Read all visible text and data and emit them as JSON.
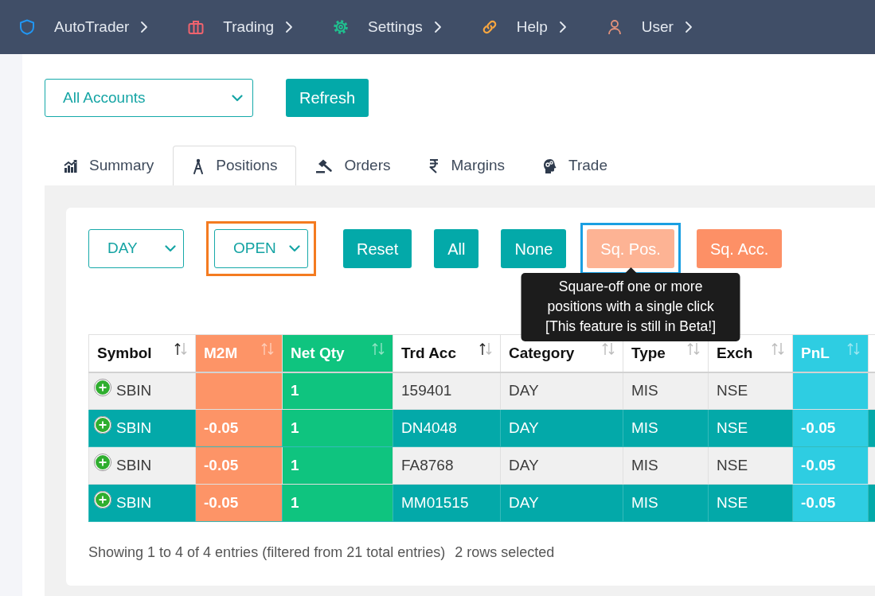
{
  "navbar": {
    "items": [
      {
        "label": "AutoTrader"
      },
      {
        "label": "Trading"
      },
      {
        "label": "Settings"
      },
      {
        "label": "Help"
      },
      {
        "label": "User"
      }
    ]
  },
  "toolbar": {
    "account_select": {
      "value": "All Accounts"
    },
    "refresh_button": {
      "label": "Refresh"
    }
  },
  "tabs": [
    {
      "label": "Summary",
      "selected": false
    },
    {
      "label": "Positions",
      "selected": true
    },
    {
      "label": "Orders",
      "selected": false
    },
    {
      "label": "Margins",
      "selected": false
    },
    {
      "label": "Trade",
      "selected": false
    }
  ],
  "filters": [
    {
      "value": "DAY",
      "highlighted": false
    },
    {
      "value": "OPEN",
      "highlighted": true
    }
  ],
  "buttons": [
    {
      "label": "Reset",
      "kind": "primary",
      "highlighted": false
    },
    {
      "label": "All",
      "kind": "primary",
      "highlighted": false
    },
    {
      "label": "None",
      "kind": "primary",
      "highlighted": false
    },
    {
      "label": "Sq. Pos.",
      "kind": "warning",
      "highlighted": true,
      "tooltip": "Square-off one or more positions with a single click [This feature is still in Beta!]"
    },
    {
      "label": "Sq. Acc.",
      "kind": "warning",
      "highlighted": false
    }
  ],
  "table": {
    "columns": [
      {
        "label": "Symbol",
        "sorted": true
      },
      {
        "label": "M2M",
        "sorted": false,
        "color": "#fd9467"
      },
      {
        "label": "Net Qty",
        "sorted": false,
        "color": "#0fc47f"
      },
      {
        "label": "Trd Acc",
        "sorted": true
      },
      {
        "label": "Category",
        "sorted": false
      },
      {
        "label": "Type",
        "sorted": false
      },
      {
        "label": "Exch",
        "sorted": false
      },
      {
        "label": "PnL",
        "sorted": false,
        "color": "#2ecde2"
      }
    ],
    "rows": [
      {
        "selected": false,
        "cells": [
          "SBIN",
          null,
          "1",
          "159401",
          "DAY",
          "MIS",
          "NSE",
          null
        ]
      },
      {
        "selected": true,
        "cells": [
          "SBIN",
          "-0.05",
          "1",
          "DN4048",
          "DAY",
          "MIS",
          "NSE",
          "-0.05"
        ]
      },
      {
        "selected": false,
        "cells": [
          "SBIN",
          "-0.05",
          "1",
          "FA8768",
          "DAY",
          "MIS",
          "NSE",
          "-0.05"
        ]
      },
      {
        "selected": true,
        "cells": [
          "SBIN",
          "-0.05",
          "1",
          "MM01515",
          "DAY",
          "MIS",
          "NSE",
          "-0.05"
        ]
      }
    ]
  },
  "footer": {
    "info": "Showing 1 to 4 of 4 entries (filtered from 21 total entries)",
    "selection": "2 rows selected"
  }
}
